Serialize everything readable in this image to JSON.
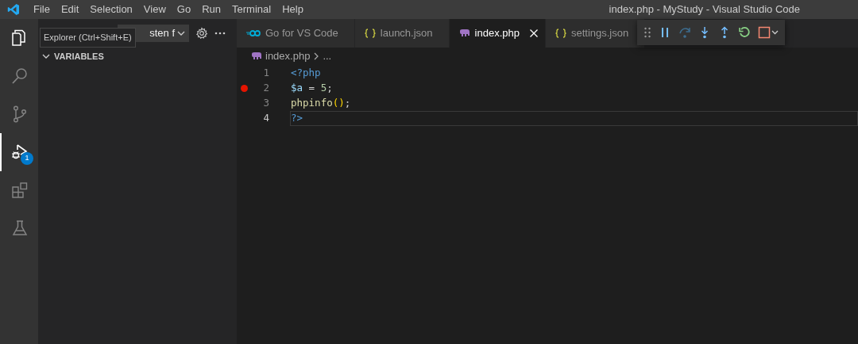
{
  "menu": [
    "File",
    "Edit",
    "Selection",
    "View",
    "Go",
    "Run",
    "Terminal",
    "Help"
  ],
  "window": {
    "title": "index.php - MyStudy - Visual Studio Code"
  },
  "activity_bar": [
    {
      "kind": "files",
      "selected": false
    },
    {
      "kind": "search",
      "selected": false
    },
    {
      "kind": "source-control",
      "selected": false
    },
    {
      "kind": "debug",
      "selected": true,
      "badge": "1"
    },
    {
      "kind": "extensions",
      "selected": false
    },
    {
      "kind": "testing",
      "selected": false
    }
  ],
  "tooltip": "Explorer (Ctrl+Shift+E)",
  "sidebar": {
    "config_dropdown": "sten f",
    "section": {
      "title": "VARIABLES",
      "expanded": true
    }
  },
  "tabs": [
    {
      "label": "Go for VS Code",
      "kind": "go",
      "selected": false
    },
    {
      "label": "launch.json",
      "kind": "json",
      "selected": false
    },
    {
      "label": "index.php",
      "kind": "php",
      "selected": true
    },
    {
      "label": "settings.json",
      "kind": "json",
      "selected": false
    }
  ],
  "debug_toolbar": [
    {
      "kind": "grip"
    },
    {
      "kind": "pause"
    },
    {
      "kind": "step-over"
    },
    {
      "kind": "step-into"
    },
    {
      "kind": "step-out"
    },
    {
      "kind": "restart"
    },
    {
      "kind": "stop"
    }
  ],
  "breadcrumb": {
    "file": "index.php",
    "rest": "..."
  },
  "code": [
    {
      "number": "1",
      "breakpoint": false,
      "current": false,
      "tokens": [
        {
          "kind": "tag",
          "text": "<?php"
        }
      ]
    },
    {
      "number": "2",
      "breakpoint": true,
      "current": false,
      "tokens": [
        {
          "kind": "var",
          "text": "$a"
        },
        {
          "kind": "plain",
          "text": " = "
        },
        {
          "kind": "num",
          "text": "5"
        },
        {
          "kind": "plain",
          "text": ";"
        }
      ]
    },
    {
      "number": "3",
      "breakpoint": false,
      "current": false,
      "tokens": [
        {
          "kind": "func",
          "text": "phpinfo"
        },
        {
          "kind": "paren",
          "text": "()"
        },
        {
          "kind": "plain",
          "text": ";"
        }
      ]
    },
    {
      "number": "4",
      "breakpoint": false,
      "current": true,
      "tokens": [
        {
          "kind": "tag",
          "text": "?>"
        }
      ]
    }
  ]
}
